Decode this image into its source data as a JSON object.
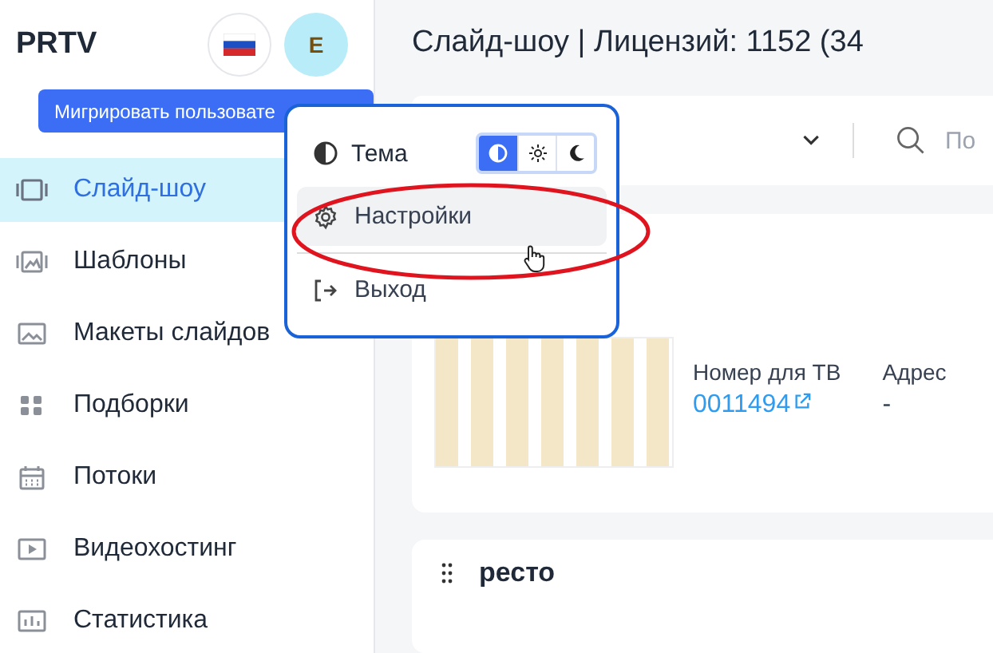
{
  "header": {
    "logo": "PRTV",
    "avatar": "E"
  },
  "tooltip": "Мигрировать пользовате",
  "sidebar": {
    "items": [
      {
        "label": "Слайд-шоу",
        "selected": true
      },
      {
        "label": "Шаблоны",
        "selected": false
      },
      {
        "label": "Макеты слайдов",
        "selected": false
      },
      {
        "label": "Подборки",
        "selected": false
      },
      {
        "label": "Потоки",
        "selected": false
      },
      {
        "label": "Видеохостинг",
        "selected": false
      },
      {
        "label": "Статистика",
        "selected": false
      }
    ]
  },
  "page_title": "Слайд-шоу | Лицензий: 1152 (34",
  "toolbar": {
    "search": {
      "placeholder": "По"
    }
  },
  "user_menu": {
    "theme": {
      "label": "Тема",
      "options": [
        {
          "selected": true
        },
        {
          "selected": false
        },
        {
          "selected": false
        }
      ]
    },
    "items": [
      {
        "label": "Настройки",
        "hovered": true
      },
      {
        "label": "Выход",
        "hovered": false
      }
    ]
  },
  "slideshows": [
    {
      "fields": [
        {
          "label": "Номер для ТВ",
          "value": "0011494",
          "kind": "link"
        },
        {
          "label": "Адрес",
          "value": "-",
          "kind": "text"
        }
      ]
    },
    {
      "title": "ресто"
    }
  ]
}
